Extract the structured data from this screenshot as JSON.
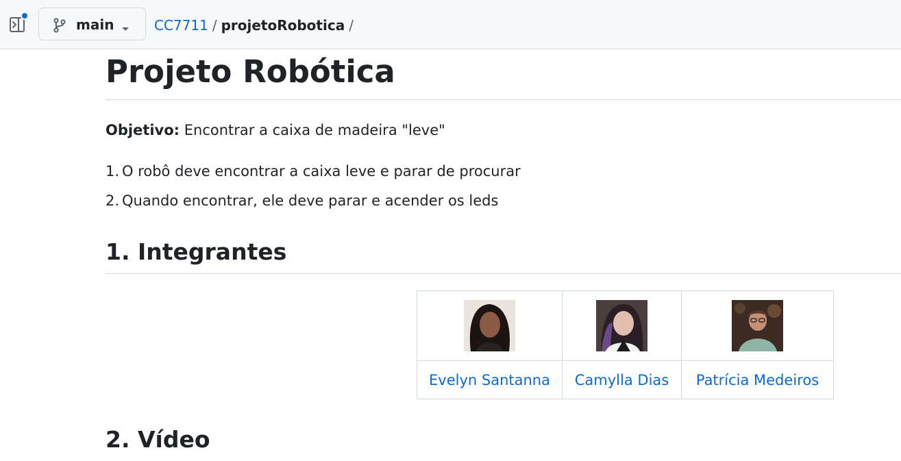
{
  "topbar": {
    "branch_label": "main",
    "breadcrumb": {
      "owner": "CC7711",
      "separator": "/",
      "repo": "projetoRobotica",
      "trailing_separator": "/"
    }
  },
  "readme": {
    "title": "Projeto Robótica",
    "objective_label": "Objetivo:",
    "objective_text": " Encontrar a caixa de madeira \"leve\"",
    "steps": [
      {
        "num": "1.",
        "text": "O robô deve encontrar a caixa leve e parar de procurar"
      },
      {
        "num": "2.",
        "text": "Quando encontrar, ele deve parar e acender os leds"
      }
    ],
    "section1_title": "1. Integrantes",
    "members": [
      {
        "name": "Evelyn Santanna"
      },
      {
        "name": "Camylla Dias"
      },
      {
        "name": "Patrícia Medeiros"
      }
    ],
    "section2_title": "2. Vídeo"
  },
  "colors": {
    "accent_link": "#0969da",
    "topbar_bg": "#f6f8fa",
    "border": "#d1d9e0",
    "text": "#1f2328"
  },
  "icons": [
    "sidebar-toggle-icon",
    "git-branch-icon",
    "triangle-down-icon"
  ]
}
